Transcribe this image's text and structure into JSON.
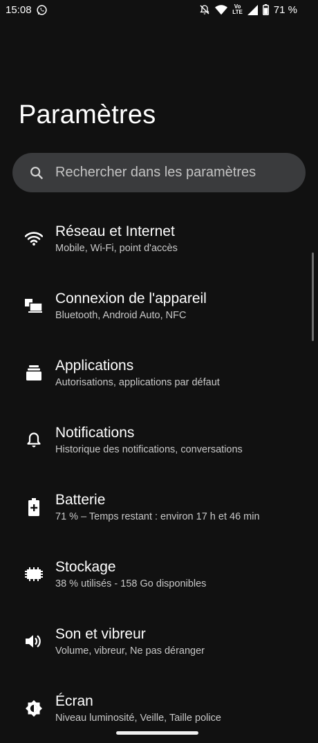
{
  "status_bar": {
    "time": "15:08",
    "battery_percent": "71 %",
    "volte_label": "Vo",
    "lte_label": "LTE",
    "icons": [
      "whatsapp-icon",
      "bell-off-icon",
      "wifi-icon",
      "volte-lte-icon",
      "signal-icon",
      "battery-icon"
    ]
  },
  "header": {
    "title": "Paramètres"
  },
  "search": {
    "placeholder": "Rechercher dans les paramètres"
  },
  "settings": {
    "items": [
      {
        "title": "Réseau et Internet",
        "subtitle": "Mobile, Wi-Fi, point d'accès",
        "icon": "wifi-icon"
      },
      {
        "title": "Connexion de l'appareil",
        "subtitle": "Bluetooth, Android Auto, NFC",
        "icon": "devices-icon"
      },
      {
        "title": "Applications",
        "subtitle": "Autorisations, applications par défaut",
        "icon": "apps-icon"
      },
      {
        "title": "Notifications",
        "subtitle": "Historique des notifications, conversations",
        "icon": "bell-icon"
      },
      {
        "title": "Batterie",
        "subtitle": "71 % – Temps restant : environ 17 h et 46 min",
        "icon": "battery-plus-icon"
      },
      {
        "title": "Stockage",
        "subtitle": "38 % utilisés - 158 Go disponibles",
        "icon": "storage-icon"
      },
      {
        "title": "Son et vibreur",
        "subtitle": "Volume, vibreur, Ne pas déranger",
        "icon": "volume-icon"
      },
      {
        "title": "Écran",
        "subtitle": "Niveau luminosité, Veille, Taille police",
        "icon": "brightness-icon"
      }
    ]
  },
  "colors": {
    "background": "#111111",
    "search_bg": "#3a3b3d",
    "text_primary": "#ffffff",
    "text_secondary": "#c8c8c8"
  }
}
